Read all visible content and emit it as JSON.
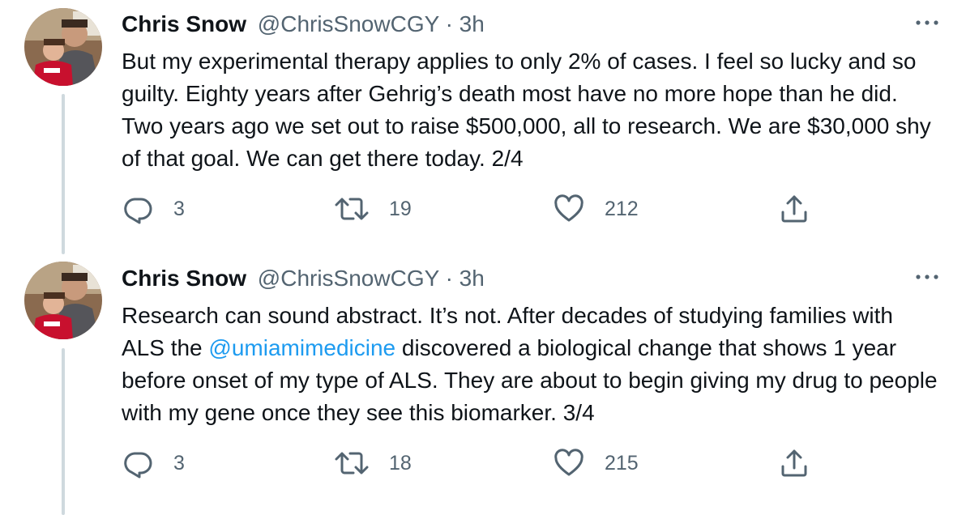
{
  "tweets": [
    {
      "author_name": "Chris Snow",
      "handle": "@ChrisSnowCGY",
      "separator": "·",
      "time": "3h",
      "text_before_mention": "But my experimental therapy applies to only 2% of cases. I feel so lucky and so guilty. Eighty years after Gehrig’s death most have no more hope than he did. Two years ago we set out to raise $500,000, all to research. We are $30,000 shy of that goal. We can get there today. 2/4",
      "mention": "",
      "text_after_mention": "",
      "replies": "3",
      "retweets": "19",
      "likes": "212",
      "icons": [
        "reply-icon",
        "retweet-icon",
        "like-icon",
        "share-icon",
        "more-icon"
      ]
    },
    {
      "author_name": "Chris Snow",
      "handle": "@ChrisSnowCGY",
      "separator": "·",
      "time": "3h",
      "text_before_mention": "Research can sound abstract. It’s not. After decades of studying families with ALS the ",
      "mention": "@umiamimedicine",
      "text_after_mention": " discovered a biological change that shows 1 year before onset of my type of ALS. They are about to begin giving my drug to people with my gene once they see this biomarker. 3/4",
      "replies": "3",
      "retweets": "18",
      "likes": "215",
      "icons": [
        "reply-icon",
        "retweet-icon",
        "like-icon",
        "share-icon",
        "more-icon"
      ]
    }
  ],
  "colors": {
    "text_primary": "#0f1419",
    "text_secondary": "#536471",
    "link": "#1d9bf0",
    "thread_line": "#cfd9de"
  }
}
